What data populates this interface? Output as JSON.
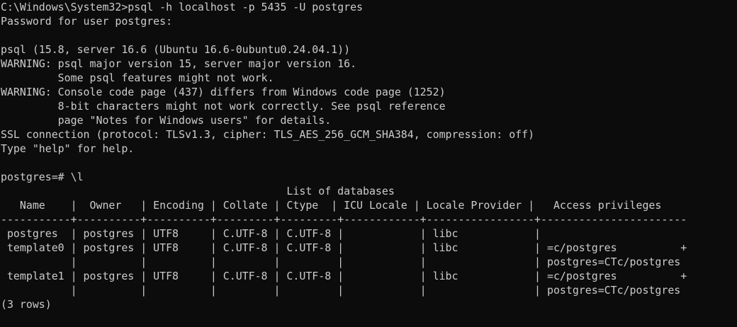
{
  "terminal": {
    "lines": [
      "C:\\Windows\\System32>psql -h localhost -p 5435 -U postgres",
      "Password for user postgres:",
      "",
      "psql (15.8, server 16.6 (Ubuntu 16.6-0ubuntu0.24.04.1))",
      "WARNING: psql major version 15, server major version 16.",
      "         Some psql features might not work.",
      "WARNING: Console code page (437) differs from Windows code page (1252)",
      "         8-bit characters might not work correctly. See psql reference",
      "         page \"Notes for Windows users\" for details.",
      "SSL connection (protocol: TLSv1.3, cipher: TLS_AES_256_GCM_SHA384, compression: off)",
      "Type \"help\" for help.",
      "",
      "postgres=# \\l",
      "                                             List of databases",
      "   Name    |  Owner   | Encoding | Collate | Ctype  | ICU Locale | Locale Provider |   Access privileges",
      "-----------+----------+----------+---------+---------+------------+-----------------+-----------------------",
      " postgres  | postgres | UTF8     | C.UTF-8 | C.UTF-8 |            | libc            |",
      " template0 | postgres | UTF8     | C.UTF-8 | C.UTF-8 |            | libc            | =c/postgres          +",
      "           |          |          |         |         |            |                 | postgres=CTc/postgres",
      " template1 | postgres | UTF8     | C.UTF-8 | C.UTF-8 |            | libc            | =c/postgres          +",
      "           |          |          |         |         |            |                 | postgres=CTc/postgres",
      "(3 rows)",
      ""
    ]
  }
}
